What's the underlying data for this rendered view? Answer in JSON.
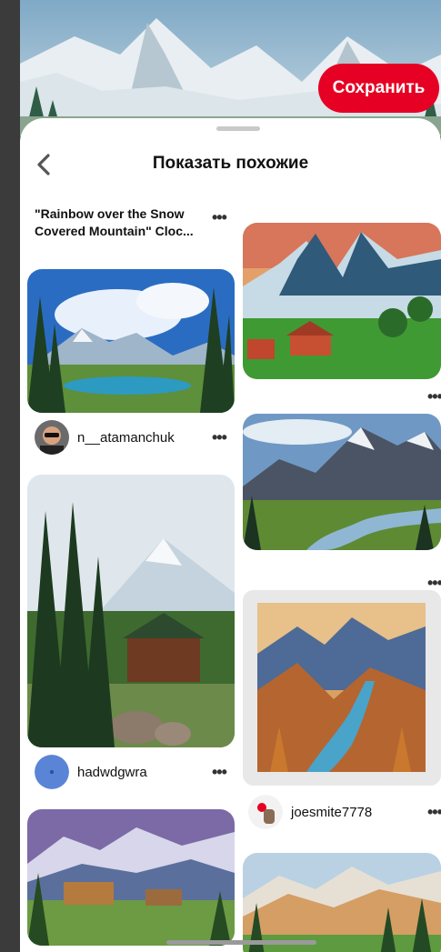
{
  "hero": {
    "save_label": "Сохранить"
  },
  "sheet": {
    "title": "Показать похожие",
    "back_icon": "chevron-left-icon"
  },
  "pins_left": [
    {
      "title": "\"Rainbow over the Snow Covered Mountain\" Cloc...",
      "menu": "•••"
    },
    {
      "username": "n__atamanchuk",
      "menu": "•••"
    },
    {
      "username": "hadwdgwra",
      "menu": "•••"
    }
  ],
  "pins_right": [
    {
      "menu": "•••"
    },
    {
      "menu": "•••"
    },
    {
      "username": "joesmite7778",
      "menu": "•••"
    }
  ],
  "colors": {
    "accent": "#e60023",
    "text": "#111111",
    "sheet_bg": "#ffffff"
  }
}
